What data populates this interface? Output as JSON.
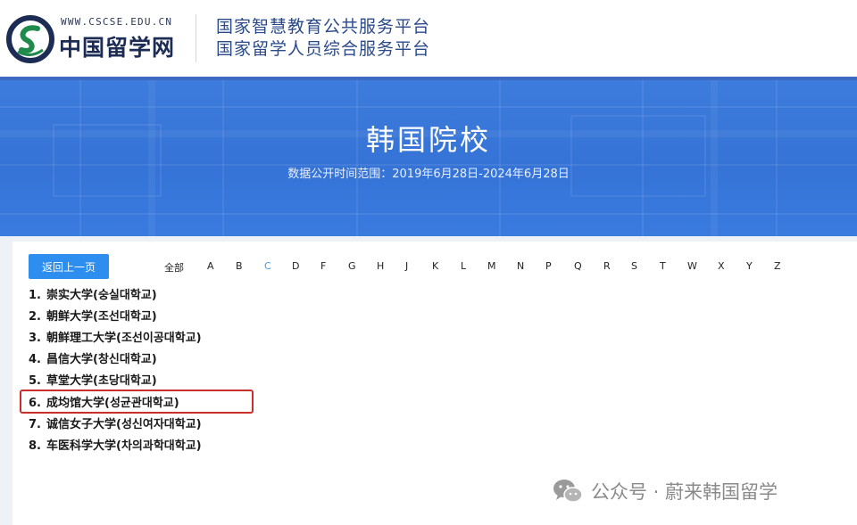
{
  "header": {
    "logo_url_text": "WWW.CSCSE.EDU.CN",
    "logo_name": "中国留学网",
    "platform_line1": "国家智慧教育公共服务平台",
    "platform_line2": "国家留学人员综合服务平台"
  },
  "banner": {
    "title": "韩国院校",
    "subtitle": "数据公开时间范围：2019年6月28日-2024年6月28日"
  },
  "toolbar": {
    "back_label": "返回上一页"
  },
  "letter_filter": {
    "items": [
      "全部",
      "A",
      "B",
      "C",
      "D",
      "F",
      "G",
      "H",
      "J",
      "K",
      "L",
      "M",
      "N",
      "P",
      "Q",
      "R",
      "S",
      "T",
      "W",
      "X",
      "Y",
      "Z"
    ],
    "active": "C"
  },
  "schools": [
    {
      "num": "1.",
      "name": "崇实大学(숭실대학교)"
    },
    {
      "num": "2.",
      "name": "朝鲜大学(조선대학교)"
    },
    {
      "num": "3.",
      "name": "朝鲜理工大学(조선이공대학교)"
    },
    {
      "num": "4.",
      "name": "昌信大学(창신대학교)"
    },
    {
      "num": "5.",
      "name": "草堂大学(초당대학교)"
    },
    {
      "num": "6.",
      "name": "成均馆大学(성균관대학교)"
    },
    {
      "num": "7.",
      "name": "诚信女子大学(성신여자대학교)"
    },
    {
      "num": "8.",
      "name": "车医科学大学(차의과학대학교)"
    }
  ],
  "highlighted_school_index": 5,
  "watermark": {
    "text": "公众号 · 蔚来韩国留学"
  },
  "colors": {
    "banner_blue": "#3573d6",
    "button_blue": "#2e8ef0",
    "active_letter": "#4a9be6",
    "highlight_red": "#c9302c",
    "logo_green": "#1f8a4c",
    "logo_navy": "#1d2c55"
  }
}
